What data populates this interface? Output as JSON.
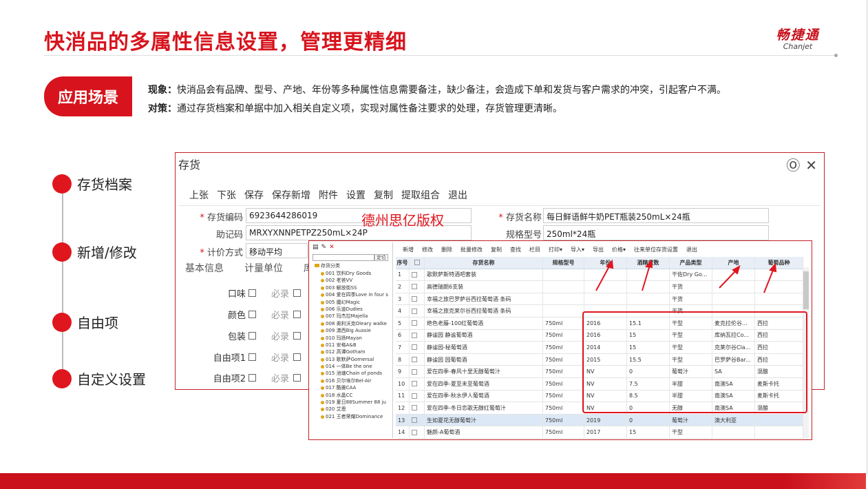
{
  "slide": {
    "title": "快消品的多属性信息设置，管理更精细",
    "logo_cn": "畅捷通",
    "logo_en": "Chanjet",
    "scene_badge": "应用场景",
    "phenomenon_label": "现象：",
    "phenomenon_text": "快消品会有品牌、型号、产地、年份等多种属性信息需要备注，缺少备注，会造成下单和发货与客户需求的冲突，引起客户不满。",
    "measure_label": "对策：",
    "measure_text": "通过存货档案和单据中加入相关自定义项，实现对属性备注要求的处理，存货管理更清晰。",
    "timeline": [
      "存货档案",
      "新增/修改",
      "自由项",
      "自定义设置"
    ],
    "accent_color": "#d7141d"
  },
  "inventory_window": {
    "title": "存货",
    "toolbar": [
      "上张",
      "下张",
      "保存",
      "保存新增",
      "附件",
      "设置",
      "复制",
      "提取组合",
      "退出"
    ],
    "watermark": "德州思亿版权",
    "fields": {
      "code_label": "存货编码",
      "code_value": "6923644286019",
      "mnemonic_label": "助记码",
      "mnemonic_value": "MRXYXNNPETPZ250mL×24P",
      "valuation_label": "计价方式",
      "valuation_value": "移动平均",
      "name_label": "存货名称",
      "name_value": "每日鲜语鲜牛奶PET瓶装250mL×24瓶",
      "spec_label": "规格型号",
      "spec_value": "250ml*24瓶"
    },
    "tabs": [
      "基本信息",
      "计量单位",
      "库"
    ],
    "free_items": [
      {
        "label": "口味",
        "must": "必录"
      },
      {
        "label": "颜色",
        "must": "必录"
      },
      {
        "label": "包装",
        "must": "必录"
      },
      {
        "label": "自由项1",
        "must": "必录"
      },
      {
        "label": "自由项2",
        "must": "必录"
      }
    ]
  },
  "list_window": {
    "tree_root": "存货分类",
    "tree_search_btn": "定位",
    "tree_items": [
      "001 饮料Dry Goods",
      "002 老爸VV",
      "003 解放街SS",
      "004 爱在四季Love in four s",
      "005 魔幻Magic",
      "006 乐迪Dudies",
      "007 玛杰拉Majella",
      "008 奥利沃克Oleary walke",
      "009 澳西Big Aussie",
      "010 玛扬Mayan",
      "011 安格A&B",
      "012 高谭Gotham",
      "013 歌默萨Gomersal",
      "014 一体Be the one",
      "015 池塘Chain of ponds",
      "016 贝尔埃尔Bel-Air",
      "017 酷雅CAA",
      "018 水晶CC",
      "019 夏日88Summer 88 ju",
      "020 艾恩",
      "021 王者荣耀Dominance"
    ],
    "toolbar": [
      "新增",
      "修改",
      "删除",
      "批量修改",
      "复制",
      "查找",
      "栏目",
      "打印▾",
      "导入▾",
      "导出",
      "价格▾",
      "往来单位存货设置",
      "退出"
    ],
    "columns": [
      "序号",
      "",
      "存货名称",
      "规格型号",
      "年份",
      "酒精度数",
      "产品类型",
      "产地",
      "葡萄品种"
    ],
    "rows": [
      [
        "1",
        "",
        "歌默萨斯特酒吧套装",
        "",
        "",
        "",
        "干佐Dry Go...",
        "",
        ""
      ],
      [
        "2",
        "",
        "高德瑞朗6支装",
        "",
        "",
        "",
        "干货",
        "",
        ""
      ],
      [
        "3",
        "",
        "幸福之旅巴罗萨谷西拉葡萄酒 条码",
        "",
        "",
        "",
        "干货",
        "",
        ""
      ],
      [
        "4",
        "",
        "幸福之旅克莱尔谷西拉葡萄酒 条码",
        "",
        "",
        "",
        "干货",
        "",
        ""
      ],
      [
        "5",
        "",
        "绝色老藤-100红葡萄酒",
        "750ml",
        "2016",
        "15.1",
        "干型",
        "麦克拉伦谷...",
        "西拉"
      ],
      [
        "6",
        "",
        "静谧园 静谧葡萄酒",
        "750ml",
        "2016",
        "15",
        "干型",
        "库纳瓦拉Co...",
        "西拉"
      ],
      [
        "7",
        "",
        "静谧园-秘葡萄酒",
        "750ml",
        "2014",
        "15",
        "干型",
        "克莱尔谷Cla...",
        "西拉"
      ],
      [
        "8",
        "",
        "静谧园 园葡萄酒",
        "750ml",
        "2015",
        "15.5",
        "干型",
        "巴罗萨谷Bar...",
        "西拉"
      ],
      [
        "9",
        "",
        "爱在四季-春风十里无醇葡萄汁",
        "750ml",
        "NV",
        "0",
        "葡萄汁",
        "SA",
        "混酿"
      ],
      [
        "10",
        "",
        "爱在四季-夏至未至葡萄酒",
        "750ml",
        "NV",
        "7.5",
        "半甜",
        "南澳SA",
        "麦斯卡托"
      ],
      [
        "11",
        "",
        "爱在四季-秋水伊人葡萄酒",
        "750ml",
        "NV",
        "8.5",
        "半甜",
        "南澳SA",
        "麦斯卡托"
      ],
      [
        "12",
        "",
        "爱在四季-冬日恋歌无醇红葡萄汁",
        "750ml",
        "NV",
        "0",
        "无醇",
        "南澳SA",
        "混酿"
      ],
      [
        "13",
        "",
        "生如夏花无醇葡萄汁",
        "750ml",
        "2019",
        "0",
        "葡萄汁",
        "澳大利亚",
        ""
      ],
      [
        "14",
        "",
        "魅颜-A葡萄酒",
        "750ml",
        "2017",
        "15",
        "干型",
        "",
        ""
      ]
    ],
    "selected_row": 12
  }
}
